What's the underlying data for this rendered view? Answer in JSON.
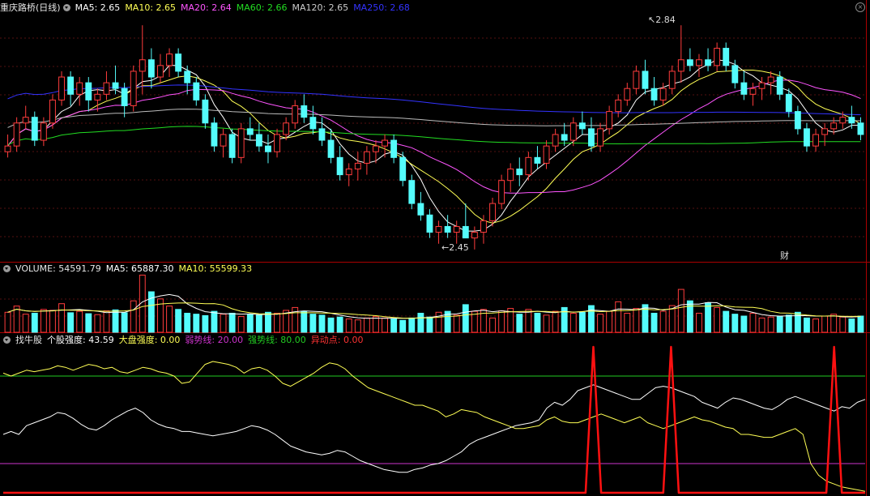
{
  "colors": {
    "up": "#ff3c3c",
    "down": "#54fcfc",
    "frame": "#aa0000",
    "grid": "#551111",
    "ma5": "#ffffff",
    "ma10": "#ffff55",
    "ma20": "#ff55ff",
    "ma60": "#22dd22",
    "ma120": "#bbbbbb",
    "ma250": "#3333ff",
    "strong": "#22cc22",
    "weak": "#cc33cc",
    "signal": "#ff1111",
    "vol_ma5": "#ffffff",
    "vol_ma10": "#ffff55"
  },
  "header": {
    "title": "重庆路桥(日线)",
    "ma5": "MA5: 2.65",
    "ma10": "MA10: 2.65",
    "ma20": "MA20: 2.64",
    "ma60": "MA60: 2.66",
    "ma120": "MA120: 2.65",
    "ma250": "MA250: 2.68"
  },
  "icons": {
    "dropdown": "chevron-down-icon",
    "close": "close-icon"
  },
  "price_panel": {
    "high_label": "2.84",
    "low_label": "2.45",
    "marker": "财",
    "ylim": [
      2.43,
      2.86
    ]
  },
  "volume_panel": {
    "label": "VOLUME: 54591.79",
    "ma5": "MA5: 65887.30",
    "ma10": "MA10: 55599.33"
  },
  "indicator_panel": {
    "name": "找牛股",
    "individual": "个股强度: 43.59",
    "market": "大盘强度: 0.00",
    "weak": "弱势线: 20.00",
    "strong": "强势线: 80.00",
    "abnormal": "异动点: 0.00"
  },
  "chart_data": [
    {
      "type": "candlestick",
      "ohlc": [
        [
          2.62,
          2.65,
          2.61,
          2.63
        ],
        [
          2.63,
          2.68,
          2.62,
          2.67
        ],
        [
          2.67,
          2.7,
          2.66,
          2.68
        ],
        [
          2.68,
          2.69,
          2.63,
          2.64
        ],
        [
          2.64,
          2.68,
          2.63,
          2.67
        ],
        [
          2.67,
          2.72,
          2.66,
          2.71
        ],
        [
          2.71,
          2.76,
          2.7,
          2.75
        ],
        [
          2.75,
          2.76,
          2.7,
          2.72
        ],
        [
          2.72,
          2.75,
          2.7,
          2.74
        ],
        [
          2.74,
          2.75,
          2.69,
          2.71
        ],
        [
          2.71,
          2.73,
          2.69,
          2.72
        ],
        [
          2.72,
          2.76,
          2.71,
          2.74
        ],
        [
          2.74,
          2.77,
          2.72,
          2.73
        ],
        [
          2.73,
          2.74,
          2.68,
          2.7
        ],
        [
          2.7,
          2.77,
          2.69,
          2.76
        ],
        [
          2.76,
          2.84,
          2.72,
          2.78
        ],
        [
          2.78,
          2.8,
          2.73,
          2.75
        ],
        [
          2.75,
          2.79,
          2.74,
          2.77
        ],
        [
          2.77,
          2.8,
          2.75,
          2.79
        ],
        [
          2.79,
          2.8,
          2.75,
          2.76
        ],
        [
          2.76,
          2.77,
          2.72,
          2.74
        ],
        [
          2.74,
          2.75,
          2.7,
          2.71
        ],
        [
          2.71,
          2.72,
          2.66,
          2.67
        ],
        [
          2.67,
          2.68,
          2.62,
          2.63
        ],
        [
          2.63,
          2.66,
          2.61,
          2.65
        ],
        [
          2.65,
          2.66,
          2.6,
          2.61
        ],
        [
          2.61,
          2.67,
          2.6,
          2.66
        ],
        [
          2.66,
          2.68,
          2.64,
          2.65
        ],
        [
          2.65,
          2.67,
          2.62,
          2.63
        ],
        [
          2.63,
          2.65,
          2.6,
          2.62
        ],
        [
          2.62,
          2.66,
          2.61,
          2.65
        ],
        [
          2.65,
          2.68,
          2.64,
          2.67
        ],
        [
          2.67,
          2.71,
          2.66,
          2.7
        ],
        [
          2.7,
          2.72,
          2.67,
          2.68
        ],
        [
          2.68,
          2.7,
          2.65,
          2.66
        ],
        [
          2.66,
          2.68,
          2.63,
          2.64
        ],
        [
          2.64,
          2.66,
          2.6,
          2.61
        ],
        [
          2.61,
          2.63,
          2.57,
          2.58
        ],
        [
          2.58,
          2.6,
          2.56,
          2.59
        ],
        [
          2.59,
          2.62,
          2.57,
          2.6
        ],
        [
          2.6,
          2.63,
          2.58,
          2.62
        ],
        [
          2.62,
          2.64,
          2.6,
          2.63
        ],
        [
          2.63,
          2.65,
          2.61,
          2.64
        ],
        [
          2.64,
          2.65,
          2.6,
          2.61
        ],
        [
          2.61,
          2.62,
          2.56,
          2.57
        ],
        [
          2.57,
          2.58,
          2.52,
          2.53
        ],
        [
          2.53,
          2.55,
          2.5,
          2.51
        ],
        [
          2.51,
          2.52,
          2.47,
          2.48
        ],
        [
          2.48,
          2.5,
          2.46,
          2.49
        ],
        [
          2.49,
          2.51,
          2.47,
          2.48
        ],
        [
          2.48,
          2.5,
          2.46,
          2.49
        ],
        [
          2.49,
          2.53,
          2.48,
          2.47
        ],
        [
          2.47,
          2.49,
          2.45,
          2.48
        ],
        [
          2.48,
          2.51,
          2.46,
          2.5
        ],
        [
          2.5,
          2.54,
          2.49,
          2.53
        ],
        [
          2.53,
          2.58,
          2.52,
          2.57
        ],
        [
          2.57,
          2.6,
          2.55,
          2.59
        ],
        [
          2.59,
          2.61,
          2.56,
          2.58
        ],
        [
          2.58,
          2.62,
          2.57,
          2.61
        ],
        [
          2.61,
          2.63,
          2.59,
          2.6
        ],
        [
          2.6,
          2.64,
          2.59,
          2.63
        ],
        [
          2.63,
          2.66,
          2.62,
          2.65
        ],
        [
          2.65,
          2.67,
          2.63,
          2.64
        ],
        [
          2.64,
          2.68,
          2.63,
          2.67
        ],
        [
          2.67,
          2.69,
          2.65,
          2.66
        ],
        [
          2.66,
          2.68,
          2.62,
          2.63
        ],
        [
          2.63,
          2.67,
          2.62,
          2.66
        ],
        [
          2.66,
          2.7,
          2.65,
          2.69
        ],
        [
          2.69,
          2.72,
          2.68,
          2.71
        ],
        [
          2.71,
          2.74,
          2.7,
          2.73
        ],
        [
          2.73,
          2.77,
          2.72,
          2.76
        ],
        [
          2.76,
          2.78,
          2.72,
          2.73
        ],
        [
          2.73,
          2.75,
          2.7,
          2.71
        ],
        [
          2.71,
          2.74,
          2.7,
          2.73
        ],
        [
          2.73,
          2.77,
          2.72,
          2.76
        ],
        [
          2.76,
          2.84,
          2.74,
          2.78
        ],
        [
          2.78,
          2.8,
          2.76,
          2.77
        ],
        [
          2.77,
          2.79,
          2.75,
          2.78
        ],
        [
          2.78,
          2.8,
          2.76,
          2.77
        ],
        [
          2.77,
          2.81,
          2.76,
          2.8
        ],
        [
          2.8,
          2.81,
          2.76,
          2.77
        ],
        [
          2.77,
          2.78,
          2.73,
          2.74
        ],
        [
          2.74,
          2.76,
          2.71,
          2.72
        ],
        [
          2.72,
          2.74,
          2.7,
          2.73
        ],
        [
          2.73,
          2.75,
          2.71,
          2.74
        ],
        [
          2.74,
          2.76,
          2.72,
          2.75
        ],
        [
          2.75,
          2.76,
          2.71,
          2.72
        ],
        [
          2.72,
          2.73,
          2.68,
          2.69
        ],
        [
          2.69,
          2.7,
          2.65,
          2.66
        ],
        [
          2.66,
          2.67,
          2.62,
          2.63
        ],
        [
          2.63,
          2.66,
          2.62,
          2.65
        ],
        [
          2.65,
          2.67,
          2.63,
          2.66
        ],
        [
          2.66,
          2.68,
          2.65,
          2.67
        ],
        [
          2.67,
          2.69,
          2.66,
          2.68
        ],
        [
          2.68,
          2.7,
          2.66,
          2.67
        ],
        [
          2.67,
          2.68,
          2.64,
          2.65
        ]
      ],
      "ma_periods": [
        5,
        10,
        20,
        60,
        120,
        250
      ]
    },
    {
      "type": "bar",
      "series_name": "VOLUME",
      "values": [
        42,
        55,
        38,
        40,
        48,
        46,
        60,
        41,
        44,
        39,
        37,
        45,
        47,
        41,
        66,
        120,
        85,
        70,
        55,
        48,
        40,
        38,
        35,
        44,
        38,
        40,
        33,
        38,
        36,
        42,
        40,
        46,
        52,
        44,
        38,
        36,
        30,
        32,
        28,
        26,
        30,
        33,
        30,
        28,
        25,
        30,
        40,
        32,
        42,
        44,
        36,
        58,
        44,
        48,
        30,
        45,
        50,
        38,
        48,
        40,
        36,
        44,
        52,
        40,
        42,
        56,
        38,
        44,
        64,
        40,
        50,
        58,
        40,
        44,
        56,
        90,
        66,
        40,
        62,
        52,
        44,
        38,
        34,
        40,
        30,
        32,
        34,
        36,
        42,
        30,
        28,
        34,
        38,
        32,
        28,
        34
      ]
    },
    {
      "type": "line",
      "title": "找牛股",
      "ylim": [
        0,
        100
      ],
      "weak_line": 20,
      "strong_line": 80,
      "series": [
        {
          "name": "个股强度",
          "values": [
            40,
            42,
            40,
            46,
            48,
            50,
            52,
            55,
            54,
            51,
            47,
            44,
            43,
            46,
            50,
            53,
            56,
            58,
            55,
            50,
            47,
            45,
            44,
            42,
            42,
            41,
            40,
            39,
            40,
            41,
            42,
            44,
            46,
            45,
            43,
            40,
            36,
            32,
            30,
            28,
            27,
            26,
            27,
            29,
            28,
            25,
            22,
            20,
            18,
            16,
            15,
            14,
            14,
            16,
            17,
            19,
            20,
            22,
            25,
            28,
            33,
            36,
            38,
            40,
            42,
            44,
            46,
            47,
            48,
            50,
            58,
            62,
            60,
            64,
            70,
            72,
            74,
            72,
            70,
            68,
            66,
            64,
            64,
            68,
            72,
            73,
            72,
            70,
            68,
            66,
            62,
            60,
            58,
            62,
            65,
            64,
            62,
            60,
            58,
            57,
            60,
            64,
            66,
            64,
            62,
            60,
            58,
            56,
            59,
            58,
            62,
            64
          ]
        },
        {
          "name": "大盘强度",
          "values": [
            82,
            80,
            82,
            84,
            83,
            84,
            85,
            87,
            86,
            84,
            86,
            88,
            87,
            85,
            86,
            83,
            82,
            84,
            86,
            85,
            83,
            82,
            80,
            75,
            76,
            82,
            88,
            90,
            89,
            88,
            86,
            82,
            85,
            86,
            84,
            80,
            75,
            73,
            76,
            79,
            82,
            86,
            89,
            88,
            85,
            80,
            76,
            72,
            70,
            68,
            66,
            64,
            62,
            60,
            60,
            58,
            56,
            52,
            54,
            57,
            56,
            55,
            52,
            50,
            48,
            46,
            44,
            44,
            45,
            46,
            50,
            52,
            49,
            48,
            48,
            50,
            52,
            54,
            52,
            50,
            48,
            50,
            52,
            48,
            46,
            44,
            46,
            48,
            50,
            52,
            50,
            49,
            47,
            45,
            44,
            40,
            40,
            39,
            38,
            38,
            40,
            42,
            44,
            40,
            20,
            12,
            8,
            6,
            4,
            3,
            2,
            1
          ]
        },
        {
          "name": "异动点",
          "values": [
            0,
            0,
            0,
            0,
            0,
            0,
            0,
            0,
            0,
            0,
            0,
            0,
            0,
            0,
            0,
            0,
            0,
            0,
            0,
            0,
            0,
            0,
            0,
            0,
            0,
            0,
            0,
            0,
            0,
            0,
            0,
            0,
            0,
            0,
            0,
            0,
            0,
            0,
            0,
            0,
            0,
            0,
            0,
            0,
            0,
            0,
            0,
            0,
            0,
            0,
            0,
            0,
            0,
            0,
            0,
            0,
            0,
            0,
            0,
            0,
            0,
            0,
            0,
            0,
            0,
            0,
            0,
            0,
            0,
            0,
            0,
            0,
            0,
            0,
            0,
            0,
            100,
            0,
            0,
            0,
            0,
            0,
            0,
            0,
            0,
            0,
            100,
            0,
            0,
            0,
            0,
            0,
            0,
            0,
            0,
            0,
            0,
            0,
            0,
            0,
            0,
            0,
            0,
            0,
            0,
            0,
            0,
            100,
            0,
            0,
            0,
            0
          ]
        }
      ]
    }
  ]
}
